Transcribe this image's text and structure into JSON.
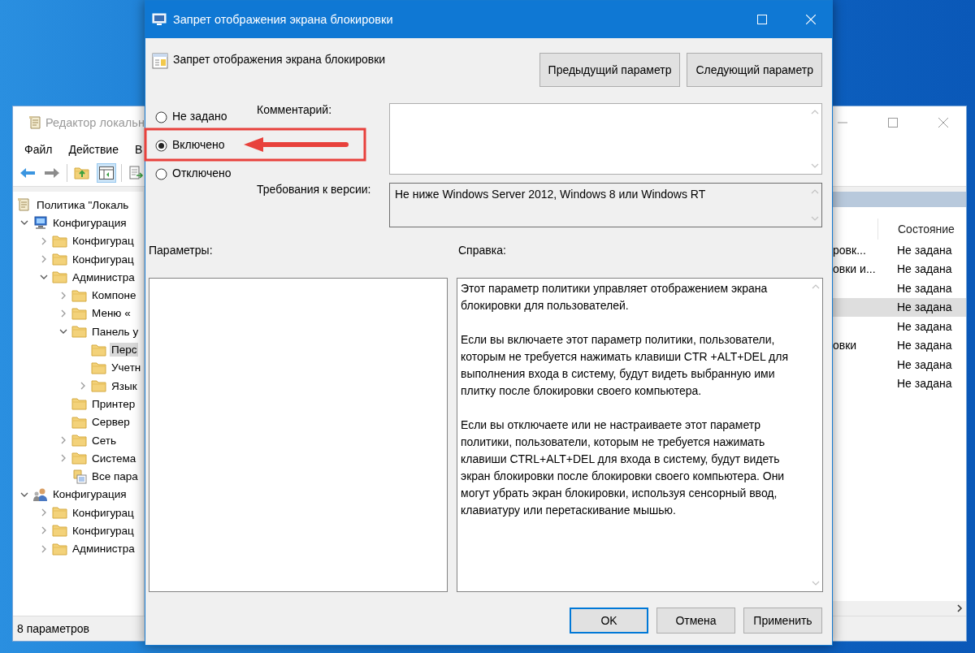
{
  "editor_window": {
    "title": "Редактор локальн",
    "menu": [
      "Файл",
      "Действие",
      "В"
    ],
    "tree": [
      {
        "label": "Политика \"Локаль",
        "kind": "policy",
        "selected": false,
        "children": [
          {
            "label": "Конфигурация",
            "kind": "computer",
            "expanded": true,
            "selected": false,
            "children": [
              {
                "label": "Конфигурац",
                "kind": "folder",
                "expanded": false,
                "selected": false
              },
              {
                "label": "Конфигурац",
                "kind": "folder",
                "expanded": false,
                "selected": false
              },
              {
                "label": "Администра",
                "kind": "folder",
                "expanded": true,
                "selected": false,
                "children": [
                  {
                    "label": "Компоне",
                    "kind": "folder",
                    "expanded": false,
                    "selected": false
                  },
                  {
                    "label": "Меню «",
                    "kind": "folder",
                    "expanded": false,
                    "selected": false
                  },
                  {
                    "label": "Панель у",
                    "kind": "folder",
                    "expanded": true,
                    "selected": false,
                    "children": [
                      {
                        "label": "Перс",
                        "kind": "folder",
                        "selected": true
                      },
                      {
                        "label": "Учетн",
                        "kind": "folder",
                        "selected": false
                      },
                      {
                        "label": "Язык",
                        "kind": "folder",
                        "expanded": false,
                        "selected": false
                      }
                    ]
                  },
                  {
                    "label": "Принтер",
                    "kind": "folder",
                    "selected": false
                  },
                  {
                    "label": "Сервер",
                    "kind": "folder",
                    "selected": false
                  },
                  {
                    "label": "Сеть",
                    "kind": "folder",
                    "expanded": false,
                    "selected": false
                  },
                  {
                    "label": "Система",
                    "kind": "folder",
                    "expanded": false,
                    "selected": false
                  },
                  {
                    "label": "Все пара",
                    "kind": "settings",
                    "selected": false
                  }
                ]
              }
            ]
          },
          {
            "label": "Конфигурация",
            "kind": "user",
            "expanded": true,
            "selected": false,
            "children": [
              {
                "label": "Конфигурац",
                "kind": "folder",
                "expanded": false,
                "selected": false
              },
              {
                "label": "Конфигурац",
                "kind": "folder",
                "expanded": false,
                "selected": false
              },
              {
                "label": "Администра",
                "kind": "folder",
                "expanded": false,
                "selected": false
              }
            ]
          }
        ]
      }
    ],
    "list": {
      "columns": [
        "Состояние"
      ],
      "rows": [
        {
          "name": "ровк...",
          "state": "Не задана",
          "selected": false
        },
        {
          "name": "овки и...",
          "state": "Не задана",
          "selected": false
        },
        {
          "state": "Не задана",
          "selected": false
        },
        {
          "state": "Не задана",
          "selected": true
        },
        {
          "state": "Не задана",
          "selected": false
        },
        {
          "name": "овки",
          "state": "Не задана",
          "selected": false
        },
        {
          "state": "Не задана",
          "selected": false
        },
        {
          "state": "Не задана",
          "selected": false
        }
      ]
    },
    "status_bar": "8 параметров"
  },
  "dialog": {
    "title": "Запрет отображения экрана блокировки",
    "policy_title": "Запрет отображения экрана блокировки",
    "nav_buttons": [
      "Предыдущий параметр",
      "Следующий параметр"
    ],
    "options": [
      {
        "label": "Не задано",
        "selected": false
      },
      {
        "label": "Включено",
        "selected": true
      },
      {
        "label": "Отключено",
        "selected": false
      }
    ],
    "comment_label": "Комментарий:",
    "requirements_label": "Требования к версии:",
    "requirements": "Не ниже Windows Server 2012, Windows 8 или Windows RT",
    "parameters_label": "Параметры:",
    "help_label": "Справка:",
    "help_text": [
      "Этот параметр политики управляет отображением экрана блокировки для пользователей.",
      "Если вы включаете этот параметр политики, пользователи, которым не требуется нажимать клавиши CTR +ALT+DEL для выполнения входа в систему, будут видеть выбранную ими плитку после блокировки своего компьютера.",
      "Если вы отключаете или не настраиваете этот параметр политики, пользователи, которым не требуется нажимать клавиши CTRL+ALT+DEL для входа в систему, будут видеть экран блокировки после блокировки своего компьютера. Они могут убрать экран блокировки, используя сенсорный ввод, клавиатуру или перетаскивание мышью."
    ],
    "buttons": [
      {
        "label": "OK",
        "default": true
      },
      {
        "label": "Отмена",
        "default": false
      },
      {
        "label": "Применить",
        "default": false
      }
    ]
  }
}
